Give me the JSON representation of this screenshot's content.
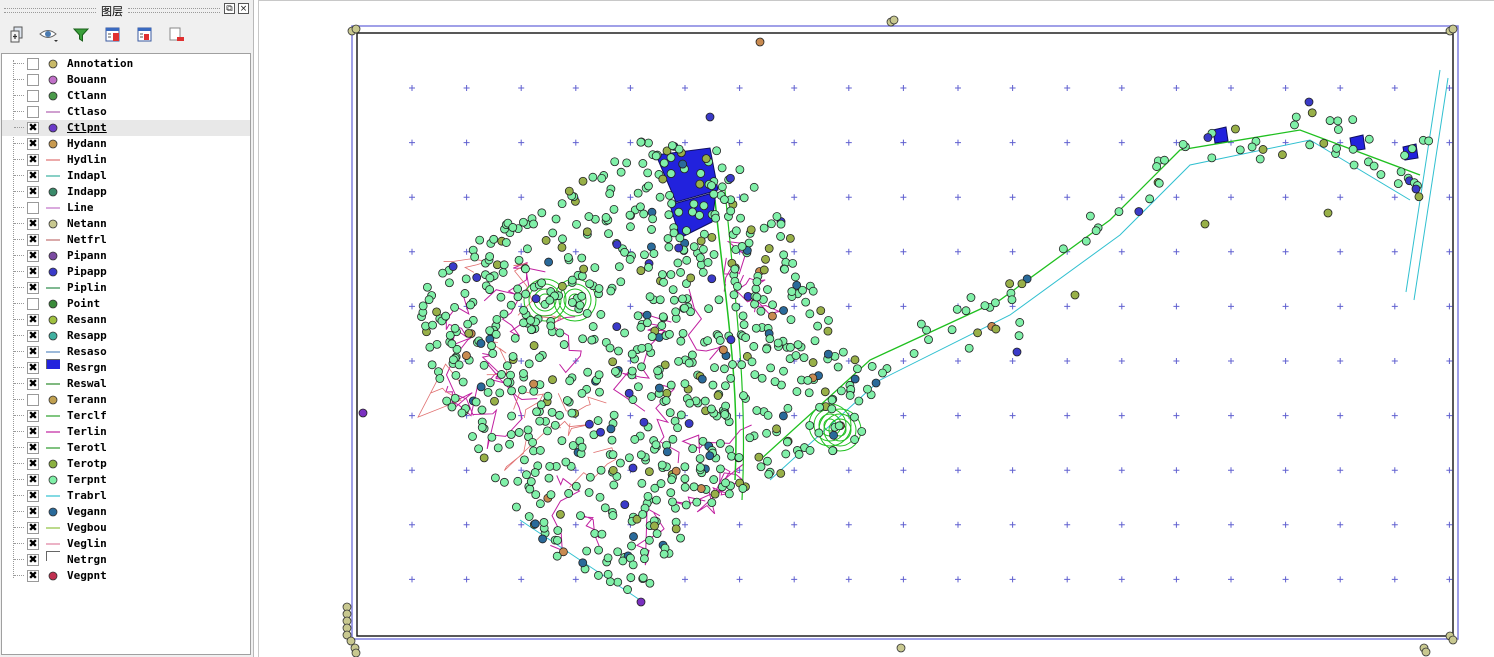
{
  "panel": {
    "title": "图层",
    "float_button": "⧉",
    "close_button": "×"
  },
  "toolbar": {
    "items": [
      {
        "name": "add-layer-icon"
      },
      {
        "name": "visibility-eye-icon"
      },
      {
        "name": "filter-icon"
      },
      {
        "name": "expand-all-icon"
      },
      {
        "name": "collapse-all-icon"
      },
      {
        "name": "remove-layer-icon"
      }
    ]
  },
  "layers": [
    {
      "name": "Annotation",
      "checked": false,
      "symbol": "point",
      "color": "#c8b968"
    },
    {
      "name": "Bouann",
      "checked": false,
      "symbol": "point",
      "color": "#c070c8"
    },
    {
      "name": "Ctlann",
      "checked": false,
      "symbol": "point",
      "color": "#4a9a4a"
    },
    {
      "name": "Ctlaso",
      "checked": false,
      "symbol": "line",
      "color": "#b060b0"
    },
    {
      "name": "Ctlpnt",
      "checked": true,
      "symbol": "point",
      "color": "#6a3ac8",
      "selected": true
    },
    {
      "name": "Hydann",
      "checked": true,
      "symbol": "point",
      "color": "#c89a50"
    },
    {
      "name": "Hydlin",
      "checked": true,
      "symbol": "line",
      "color": "#e07070"
    },
    {
      "name": "Indapl",
      "checked": true,
      "symbol": "line",
      "color": "#3ab0a0"
    },
    {
      "name": "Indapp",
      "checked": true,
      "symbol": "point",
      "color": "#3a8a6a"
    },
    {
      "name": "Line",
      "checked": false,
      "symbol": "line",
      "color": "#c070c8"
    },
    {
      "name": "Netann",
      "checked": true,
      "symbol": "point",
      "color": "#c8c890"
    },
    {
      "name": "Netfrl",
      "checked": true,
      "symbol": "line",
      "color": "#c07070"
    },
    {
      "name": "Pipann",
      "checked": true,
      "symbol": "point",
      "color": "#7a4aa0"
    },
    {
      "name": "Pipapp",
      "checked": true,
      "symbol": "point",
      "color": "#3a3ac8"
    },
    {
      "name": "Piplin",
      "checked": true,
      "symbol": "line",
      "color": "#2a8a4a"
    },
    {
      "name": "Point",
      "checked": false,
      "symbol": "point",
      "color": "#3a8a3a"
    },
    {
      "name": "Resann",
      "checked": true,
      "symbol": "point",
      "color": "#a0c040"
    },
    {
      "name": "Resapp",
      "checked": true,
      "symbol": "point",
      "color": "#40b0a0"
    },
    {
      "name": "Resaso",
      "checked": true,
      "symbol": "line",
      "color": "#5a8ac0"
    },
    {
      "name": "Resrgn",
      "checked": true,
      "symbol": "polygon",
      "color": "#2222dd"
    },
    {
      "name": "Reswal",
      "checked": true,
      "symbol": "line",
      "color": "#2a8a2a"
    },
    {
      "name": "Terann",
      "checked": false,
      "symbol": "point",
      "color": "#c0a050"
    },
    {
      "name": "Terclf",
      "checked": true,
      "symbol": "line",
      "color": "#2aa02a"
    },
    {
      "name": "Terlin",
      "checked": true,
      "symbol": "line",
      "color": "#c020a0"
    },
    {
      "name": "Terotl",
      "checked": true,
      "symbol": "line",
      "color": "#2a9a2a"
    },
    {
      "name": "Terotp",
      "checked": true,
      "symbol": "point",
      "color": "#8ab040"
    },
    {
      "name": "Terpnt",
      "checked": true,
      "symbol": "point",
      "color": "#80f0a8"
    },
    {
      "name": "Trabrl",
      "checked": true,
      "symbol": "line",
      "color": "#30c0d0"
    },
    {
      "name": "Vegann",
      "checked": true,
      "symbol": "point",
      "color": "#2a6a9a"
    },
    {
      "name": "Vegbou",
      "checked": true,
      "symbol": "line",
      "color": "#90c040"
    },
    {
      "name": "Veglin",
      "checked": true,
      "symbol": "line",
      "color": "#e080a0"
    },
    {
      "name": "Netrgn",
      "checked": true,
      "symbol": "polygon",
      "color": "#ffffff"
    },
    {
      "name": "Vegpnt",
      "checked": true,
      "symbol": "point",
      "color": "#c03050"
    }
  ],
  "map": {
    "background": "#ffffff",
    "grid_color": "#6060d0",
    "frame_color": "#202020",
    "extent_color": "#8080e0",
    "colors": {
      "terpnt": "#80f0a8",
      "terotp": "#98b048",
      "vegann": "#2a6a9a",
      "pipapp": "#3a3ac8",
      "terlin": "#c020a0",
      "hydlin": "#e07070",
      "terclf": "#20c020",
      "trabrl": "#30c0d0",
      "resrgn": "#2222dd",
      "netann": "#c8c890",
      "ctlpnt": "#7a30c0",
      "hydann": "#c88a50"
    }
  }
}
